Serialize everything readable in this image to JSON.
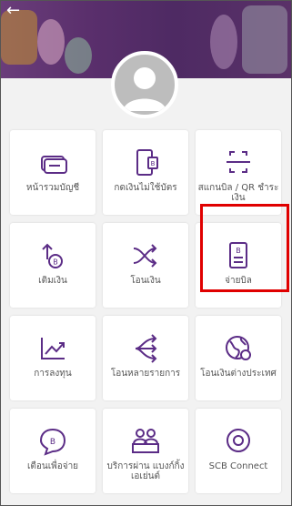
{
  "colors": {
    "accent": "#5b2c86",
    "highlight": "#e00000",
    "banner": "#5a2f6c"
  },
  "header": {
    "back_icon": "back-arrow-icon",
    "avatar_icon": "user-avatar-icon"
  },
  "menu": [
    {
      "label": "หน้ารวมบัญชี",
      "icon": "account-card-icon"
    },
    {
      "label": "กดเงินไม่ใช้บัตร",
      "icon": "atm-cardless-icon"
    },
    {
      "label": "สแกนบิล / QR ชำระเงิน",
      "icon": "qr-scan-icon"
    },
    {
      "label": "เติมเงิน",
      "icon": "topup-icon"
    },
    {
      "label": "โอนเงิน",
      "icon": "transfer-icon"
    },
    {
      "label": "จ่ายบิล",
      "icon": "pay-bill-icon"
    },
    {
      "label": "การลงทุน",
      "icon": "investment-chart-icon"
    },
    {
      "label": "โอนหลายรายการ",
      "icon": "multi-transfer-icon"
    },
    {
      "label": "โอนเงินต่างประเทศ",
      "icon": "globe-transfer-icon"
    },
    {
      "label": "เตือนเพื่อจ่าย",
      "icon": "remind-pay-icon"
    },
    {
      "label": "บริการผ่าน แบงก์กิ้งเอเย่นต์",
      "icon": "banking-agent-icon"
    },
    {
      "label": "SCB Connect",
      "icon": "scb-connect-icon"
    }
  ]
}
